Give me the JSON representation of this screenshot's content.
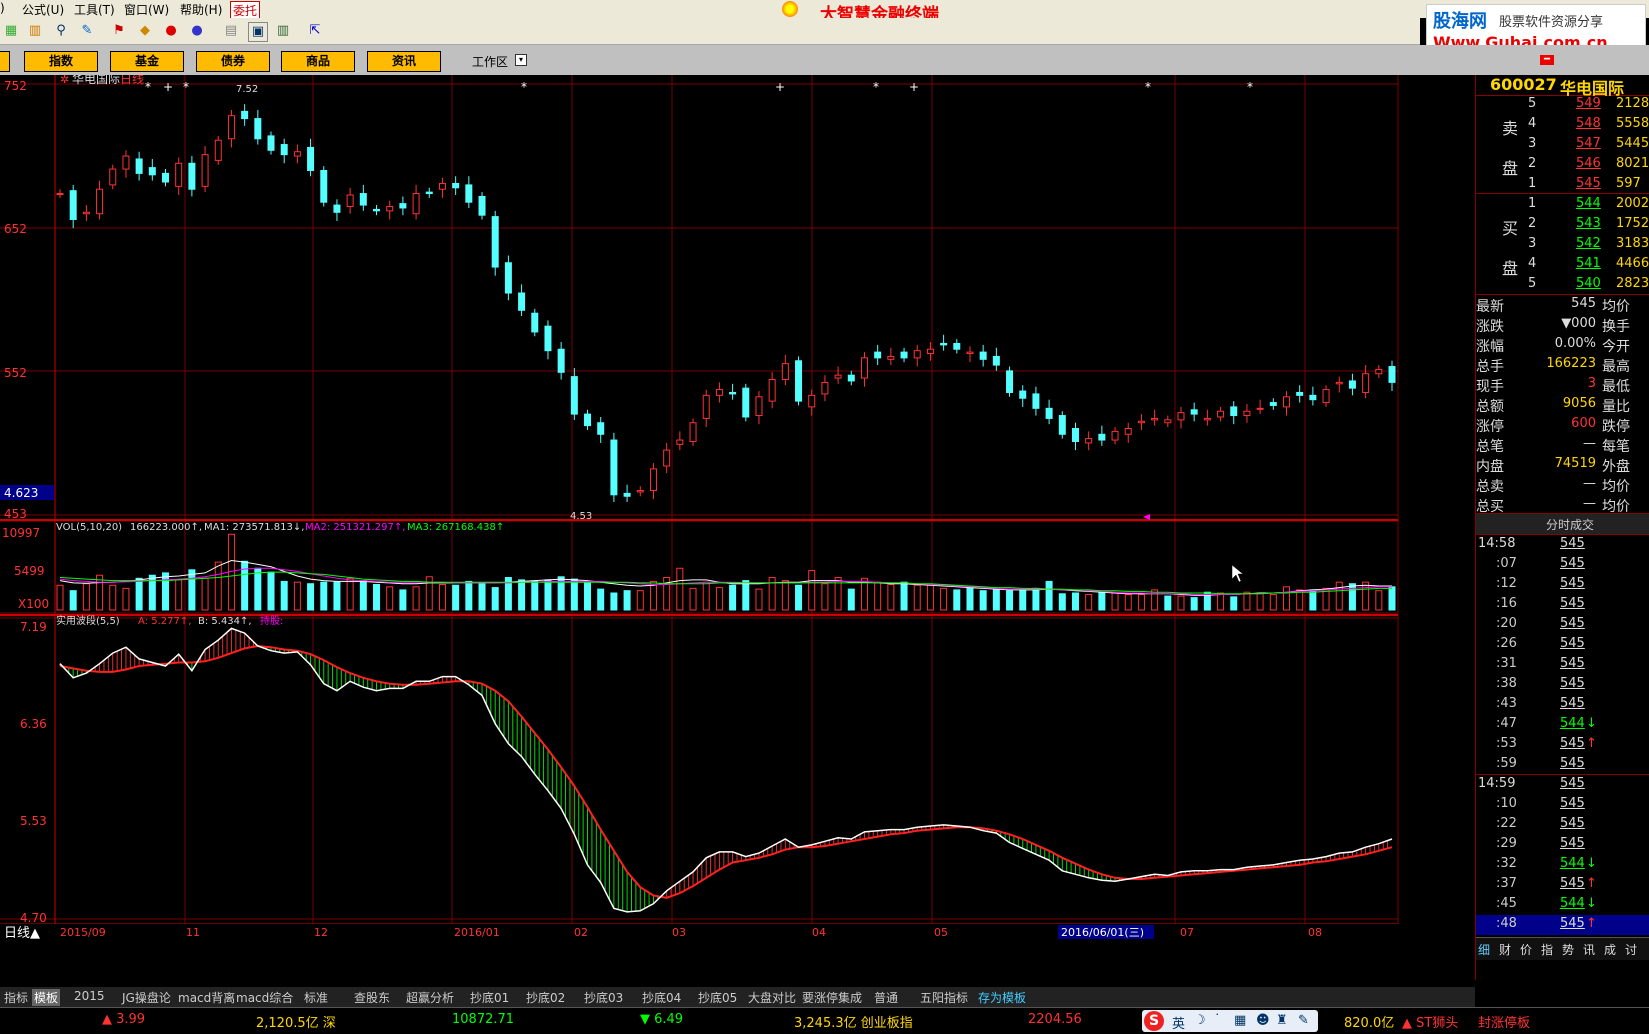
{
  "menu": {
    "items": [
      "公式(U)",
      "工具(T)",
      "窗口(W)",
      "帮助(H)",
      "委托"
    ],
    "app_title": "大智慧金融终端"
  },
  "brand": {
    "name": "股海网",
    "tagline": "股票软件资源分享",
    "url": "Www.Guhai.com.cn"
  },
  "category_tabs": [
    "指数",
    "基金",
    "债券",
    "商品",
    "资讯"
  ],
  "workspace_label": "工作区",
  "stock": {
    "code": "600027",
    "name": "华电国际",
    "period_label": "日线"
  },
  "price_chart": {
    "y_ticks": [
      "752",
      "652",
      "552",
      "453"
    ],
    "left_value_box": "4.623",
    "high_label": "7.52",
    "low_label": "4.53",
    "marker_star": "*",
    "marker_plus": "+"
  },
  "vol_chart": {
    "y_ticks": [
      "10997",
      "5499",
      "X100"
    ],
    "legend": {
      "prefix": "VOL(5,10,20)",
      "vol": "166223.000↑,",
      "ma1": "MA1: 273571.813↓,",
      "ma2": "MA2: 251321.297↑,",
      "ma3": "MA3: 267168.438↑"
    }
  },
  "wave_chart": {
    "y_ticks": [
      "7.19",
      "6.36",
      "5.53",
      "4.70"
    ],
    "legend": {
      "name": "实用波段(5,5)",
      "a": "A: 5.277↑,",
      "b": "B: 5.434↑,",
      "hold": "持股:"
    }
  },
  "date_axis": {
    "labels": [
      "2015/09",
      "11",
      "12",
      "2016/01",
      "02",
      "03",
      "04",
      "05",
      "2016/06/01(三)",
      "07",
      "08"
    ],
    "period_btn": "日线▲"
  },
  "bottom_tabs": [
    "指标",
    "模板",
    "2015",
    "JG操盘论",
    "macd背离",
    "macd综合",
    "标准",
    "查股东",
    "超赢分析",
    "抄底01",
    "抄底02",
    "抄底03",
    "抄底04",
    "抄底05",
    "大盘对比",
    "要涨停集成",
    "普通",
    "五阳指标",
    "存为模板"
  ],
  "right_panel": {
    "sell_label": [
      "卖",
      "盘"
    ],
    "buy_label": [
      "买",
      "盘"
    ],
    "sell": [
      {
        "lvl": "5",
        "price": "549",
        "vol": "2128"
      },
      {
        "lvl": "4",
        "price": "548",
        "vol": "5558"
      },
      {
        "lvl": "3",
        "price": "547",
        "vol": "5445"
      },
      {
        "lvl": "2",
        "price": "546",
        "vol": "8021"
      },
      {
        "lvl": "1",
        "price": "545",
        "vol": "597"
      }
    ],
    "buy": [
      {
        "lvl": "1",
        "price": "544",
        "vol": "2002"
      },
      {
        "lvl": "2",
        "price": "543",
        "vol": "1752"
      },
      {
        "lvl": "3",
        "price": "542",
        "vol": "3183"
      },
      {
        "lvl": "4",
        "price": "541",
        "vol": "4466"
      },
      {
        "lvl": "5",
        "price": "540",
        "vol": "2823"
      }
    ],
    "stats": [
      {
        "label": "最新",
        "value": "545",
        "label2": "均价"
      },
      {
        "label": "涨跌",
        "value": "▼000",
        "label2": "换手"
      },
      {
        "label": "涨幅",
        "value": "0.00%",
        "label2": "今开"
      },
      {
        "label": "总手",
        "value": "166223",
        "label2": "最高"
      },
      {
        "label": "现手",
        "value": "3",
        "label2": "最低"
      },
      {
        "label": "总额",
        "value": "9056",
        "label2": "量比"
      },
      {
        "label": "涨停",
        "value": "600",
        "label2": "跌停"
      },
      {
        "label": "总笔",
        "value": "—",
        "label2": "每笔"
      },
      {
        "label": "内盘",
        "value": "74519",
        "label2": "外盘"
      },
      {
        "label": "总卖",
        "value": "—",
        "label2": "均价"
      },
      {
        "label": "总买",
        "value": "—",
        "label2": "均价"
      }
    ],
    "ticks_header": "分时成交",
    "ticks": [
      {
        "t": "14:58",
        "p": "545",
        "a": ""
      },
      {
        "t": ":07",
        "p": "545",
        "a": ""
      },
      {
        "t": ":12",
        "p": "545",
        "a": ""
      },
      {
        "t": ":16",
        "p": "545",
        "a": ""
      },
      {
        "t": ":20",
        "p": "545",
        "a": ""
      },
      {
        "t": ":26",
        "p": "545",
        "a": ""
      },
      {
        "t": ":31",
        "p": "545",
        "a": ""
      },
      {
        "t": ":38",
        "p": "545",
        "a": ""
      },
      {
        "t": ":43",
        "p": "545",
        "a": ""
      },
      {
        "t": ":47",
        "p": "544",
        "a": "↓"
      },
      {
        "t": ":53",
        "p": "545",
        "a": "↑"
      },
      {
        "t": ":59",
        "p": "545",
        "a": ""
      },
      {
        "t": "14:59",
        "p": "545",
        "a": ""
      },
      {
        "t": ":10",
        "p": "545",
        "a": ""
      },
      {
        "t": ":22",
        "p": "545",
        "a": ""
      },
      {
        "t": ":29",
        "p": "545",
        "a": ""
      },
      {
        "t": ":32",
        "p": "544",
        "a": "↓"
      },
      {
        "t": ":37",
        "p": "545",
        "a": "↑"
      },
      {
        "t": ":45",
        "p": "544",
        "a": "↓"
      },
      {
        "t": ":48",
        "p": "545",
        "a": "↑"
      }
    ],
    "side_tabs": [
      "细",
      "财",
      "价",
      "指",
      "势",
      "讯",
      "成",
      "讨"
    ]
  },
  "status_bar": {
    "items": [
      "▲ 3.99",
      "2,120.5亿 深",
      "10872.71",
      "▼ 6.49",
      "3,245.3亿 创业板指",
      "2204.56",
      "820.0亿",
      "▲ ST狮头",
      "封涨停板"
    ],
    "ime": "英"
  },
  "colors": {
    "up": "#ff3232",
    "down": "#54ffff",
    "grid": "#7a0000",
    "ma1": "#ffffff",
    "ma2": "#ff00ff",
    "ma3": "#00ff00",
    "wave_a": "#ffffff",
    "wave_b": "#ff2020",
    "wave_fill_down": "#00dd00"
  },
  "chart_data": [
    {
      "type": "candlestick",
      "title": "华电国际 日线",
      "y_unit": "price x100",
      "ylim": [
        453,
        752
      ],
      "x_labels": [
        "2015/09",
        "11",
        "12",
        "2016/01",
        "02",
        "03",
        "04",
        "05",
        "06",
        "07",
        "08"
      ],
      "series": [
        {
          "name": "日线",
          "values": [
            676,
            658,
            663,
            679,
            693,
            702,
            690,
            689,
            684,
            697,
            679,
            703,
            713,
            730,
            728,
            714,
            706,
            703,
            705,
            692,
            670,
            663,
            675,
            668,
            664,
            667,
            666,
            676,
            676,
            683,
            680,
            670,
            661,
            625,
            607,
            595,
            580,
            567,
            552,
            523,
            515,
            509,
            467,
            466,
            470,
            485,
            498,
            505,
            517,
            536,
            540,
            537,
            521,
            535,
            547,
            558,
            532,
            536,
            545,
            550,
            546,
            562,
            562,
            563,
            562,
            567,
            568,
            571,
            568,
            566,
            561,
            557,
            538,
            534,
            527,
            520,
            509,
            504,
            506,
            505,
            511,
            513,
            518,
            520,
            519,
            524,
            523,
            520,
            525,
            522,
            525,
            527,
            529,
            535,
            536,
            533,
            540,
            545,
            541,
            551,
            554,
            545
          ]
        }
      ]
    },
    {
      "type": "bar",
      "title": "VOL(5,10,20)",
      "ylim": [
        0,
        10997
      ],
      "series": [
        {
          "name": "VOL",
          "values": [
            3200,
            2500,
            3400,
            4500,
            3200,
            2800,
            4100,
            4500,
            4800,
            3900,
            5200,
            4100,
            6200,
            9800,
            6300,
            5400,
            4900,
            3700,
            3600,
            3400,
            3600,
            3600,
            4100,
            3800,
            3300,
            3000,
            2600,
            3000,
            4300,
            3300,
            3200,
            3700,
            3400,
            2900,
            4200,
            3900,
            3700,
            3900,
            4300,
            4000,
            3500,
            2700,
            2200,
            2500,
            2500,
            3700,
            4200,
            5400,
            2800,
            3600,
            2900,
            3200,
            3800,
            2700,
            4200,
            3800,
            3200,
            5100,
            3400,
            4200,
            2700,
            4100,
            3600,
            3300,
            3600,
            3200,
            3300,
            2800,
            2600,
            2900,
            2500,
            2700,
            2500,
            2600,
            2800,
            3700,
            2100,
            2200,
            2000,
            2300,
            2200,
            2000,
            2000,
            2600,
            1800,
            1800,
            1600,
            2300,
            2200,
            1700,
            2300,
            2200,
            2000,
            3000,
            2600,
            2600,
            2800,
            3600,
            3400,
            3600,
            2500,
            3000
          ]
        },
        {
          "name": "MA1",
          "values": [
            3800,
            3500,
            3450,
            3550,
            3600,
            3700,
            3900,
            4100,
            4300,
            4400,
            4600,
            4800,
            5700,
            6400,
            6200,
            5900,
            5600,
            5000,
            4400,
            4000,
            3800,
            3700,
            3700,
            3700,
            3600,
            3500,
            3400,
            3400,
            3500,
            3500,
            3500,
            3500,
            3500,
            3500,
            3600,
            3700,
            3800,
            3900,
            4000,
            3900,
            3800,
            3600,
            3400,
            3200,
            3100,
            3200,
            3500,
            3800,
            3900,
            3900,
            3600,
            3400,
            3400,
            3400,
            3500,
            3600,
            3600,
            3800,
            3800,
            3800,
            3600,
            3600,
            3500,
            3400,
            3400,
            3300,
            3200,
            3100,
            3000,
            2900,
            2800,
            2700,
            2600,
            2600,
            2600,
            2700,
            2600,
            2500,
            2400,
            2300,
            2200,
            2100,
            2100,
            2100,
            2100,
            2000,
            1900,
            1900,
            2000,
            2000,
            2100,
            2200,
            2200,
            2300,
            2500,
            2600,
            2700,
            2900,
            3100,
            3200,
            3100,
            3100
          ]
        },
        {
          "name": "MA2",
          "values": [
            4000,
            3800,
            3700,
            3600,
            3600,
            3650,
            3700,
            3800,
            3900,
            4000,
            4100,
            4300,
            4600,
            5000,
            5300,
            5400,
            5400,
            5200,
            5000,
            4700,
            4400,
            4100,
            3900,
            3800,
            3700,
            3600,
            3600,
            3600,
            3600,
            3600,
            3500,
            3500,
            3500,
            3500,
            3500,
            3600,
            3600,
            3700,
            3700,
            3700,
            3700,
            3700,
            3600,
            3500,
            3400,
            3300,
            3300,
            3400,
            3500,
            3600,
            3600,
            3600,
            3500,
            3500,
            3500,
            3500,
            3500,
            3600,
            3600,
            3700,
            3700,
            3700,
            3600,
            3500,
            3500,
            3400,
            3300,
            3200,
            3100,
            3000,
            2900,
            2800,
            2700,
            2700,
            2700,
            2700,
            2600,
            2600,
            2500,
            2400,
            2300,
            2200,
            2200,
            2100,
            2100,
            2100,
            2000,
            2000,
            2000,
            2000,
            2100,
            2100,
            2200,
            2300,
            2400,
            2500,
            2600,
            2700,
            2800,
            2900,
            3000,
            3000
          ]
        },
        {
          "name": "MA3",
          "values": [
            4200,
            4100,
            4000,
            3900,
            3800,
            3800,
            3800,
            3800,
            3800,
            3900,
            4000,
            4100,
            4200,
            4400,
            4600,
            4800,
            4900,
            4900,
            4800,
            4700,
            4600,
            4400,
            4200,
            4000,
            3900,
            3800,
            3700,
            3700,
            3600,
            3600,
            3600,
            3600,
            3600,
            3600,
            3600,
            3600,
            3600,
            3600,
            3600,
            3600,
            3600,
            3600,
            3600,
            3600,
            3500,
            3500,
            3400,
            3400,
            3400,
            3400,
            3500,
            3500,
            3500,
            3500,
            3500,
            3500,
            3500,
            3500,
            3500,
            3500,
            3500,
            3500,
            3500,
            3500,
            3500,
            3400,
            3400,
            3300,
            3200,
            3100,
            3000,
            2900,
            2900,
            2800,
            2800,
            2700,
            2700,
            2600,
            2600,
            2500,
            2500,
            2400,
            2400,
            2300,
            2300,
            2200,
            2200,
            2200,
            2100,
            2100,
            2100,
            2100,
            2200,
            2200,
            2300,
            2300,
            2400,
            2500,
            2600,
            2700,
            2800,
            2800
          ]
        }
      ]
    },
    {
      "type": "line",
      "title": "实用波段(5,5)",
      "ylim": [
        4.7,
        7.19
      ],
      "series": [
        {
          "name": "A",
          "values": [
            6.87,
            6.75,
            6.79,
            6.87,
            6.96,
            7.01,
            6.91,
            6.88,
            6.85,
            6.95,
            6.81,
            6.99,
            7.07,
            7.17,
            7.13,
            7.02,
            6.98,
            6.96,
            6.97,
            6.86,
            6.7,
            6.64,
            6.72,
            6.67,
            6.64,
            6.66,
            6.66,
            6.72,
            6.72,
            6.76,
            6.76,
            6.69,
            6.6,
            6.36,
            6.19,
            6.08,
            5.93,
            5.79,
            5.64,
            5.42,
            5.16,
            5.01,
            4.79,
            4.76,
            4.77,
            4.83,
            4.94,
            5.02,
            5.1,
            5.22,
            5.27,
            5.27,
            5.23,
            5.26,
            5.32,
            5.38,
            5.31,
            5.33,
            5.36,
            5.39,
            5.38,
            5.44,
            5.45,
            5.46,
            5.46,
            5.48,
            5.49,
            5.5,
            5.49,
            5.48,
            5.45,
            5.43,
            5.35,
            5.3,
            5.25,
            5.2,
            5.11,
            5.08,
            5.05,
            5.03,
            5.02,
            5.04,
            5.06,
            5.08,
            5.07,
            5.1,
            5.11,
            5.11,
            5.12,
            5.12,
            5.14,
            5.15,
            5.16,
            5.18,
            5.2,
            5.21,
            5.23,
            5.26,
            5.27,
            5.31,
            5.34,
            5.38
          ]
        },
        {
          "name": "B",
          "values": [
            6.85,
            6.83,
            6.81,
            6.8,
            6.8,
            6.82,
            6.85,
            6.86,
            6.87,
            6.88,
            6.88,
            6.89,
            6.92,
            6.96,
            7.0,
            7.02,
            7.01,
            6.99,
            6.98,
            6.95,
            6.9,
            6.84,
            6.79,
            6.75,
            6.72,
            6.7,
            6.69,
            6.69,
            6.7,
            6.71,
            6.72,
            6.72,
            6.7,
            6.64,
            6.55,
            6.42,
            6.28,
            6.14,
            5.99,
            5.83,
            5.65,
            5.46,
            5.28,
            5.1,
            4.97,
            4.9,
            4.88,
            4.92,
            4.98,
            5.05,
            5.12,
            5.18,
            5.2,
            5.22,
            5.25,
            5.29,
            5.31,
            5.31,
            5.32,
            5.34,
            5.36,
            5.38,
            5.4,
            5.42,
            5.43,
            5.45,
            5.46,
            5.47,
            5.48,
            5.48,
            5.47,
            5.45,
            5.42,
            5.38,
            5.33,
            5.28,
            5.22,
            5.17,
            5.12,
            5.08,
            5.05,
            5.04,
            5.04,
            5.05,
            5.06,
            5.07,
            5.08,
            5.09,
            5.1,
            5.11,
            5.12,
            5.13,
            5.14,
            5.15,
            5.16,
            5.18,
            5.19,
            5.21,
            5.23,
            5.25,
            5.28,
            5.31
          ]
        }
      ]
    }
  ]
}
